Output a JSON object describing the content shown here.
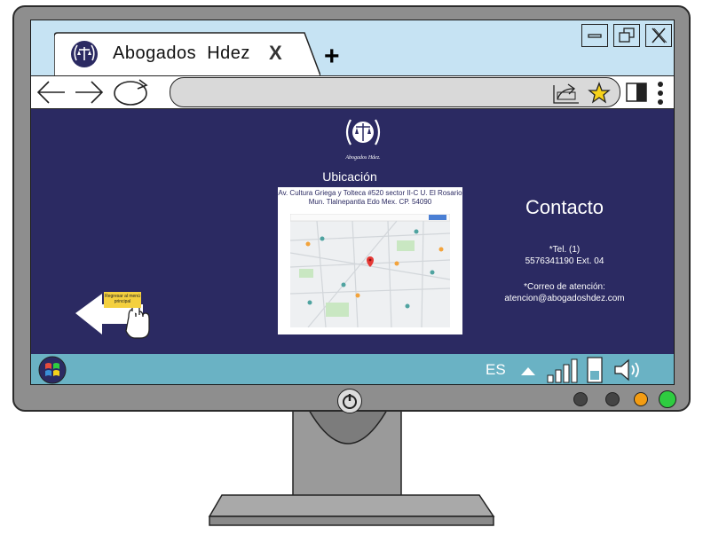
{
  "browser": {
    "tab_title": "Abogados  Hdez",
    "tab_close": "X",
    "new_tab": "+"
  },
  "page": {
    "logo_caption": "Abogados Hdez.",
    "location_title": "Ubicación",
    "address_line1": "Av. Cultura Griega y Tolteca #520 sector II-C U. El Rosario",
    "address_line2": "Mun. Tlalnepantla Edo Mex. CP. 54090",
    "contact_title": "Contacto",
    "phone_line1": "*Tel. (1)",
    "phone_line2": "5576341190 Ext. 04",
    "email_line1": "*Correo de atención:",
    "email_line2": "atencion@abogadoshdez.com",
    "back_label": "Regresar al menú principal"
  },
  "taskbar": {
    "language": "ES"
  },
  "colors": {
    "page_bg": "#2b2a62",
    "taskbar": "#6ab2c4",
    "chrome": "#c6e3f3",
    "bezel": "#8e8e8e",
    "star": "#f6d21a",
    "led_orange": "#f39c12",
    "led_green": "#2ecc40"
  }
}
